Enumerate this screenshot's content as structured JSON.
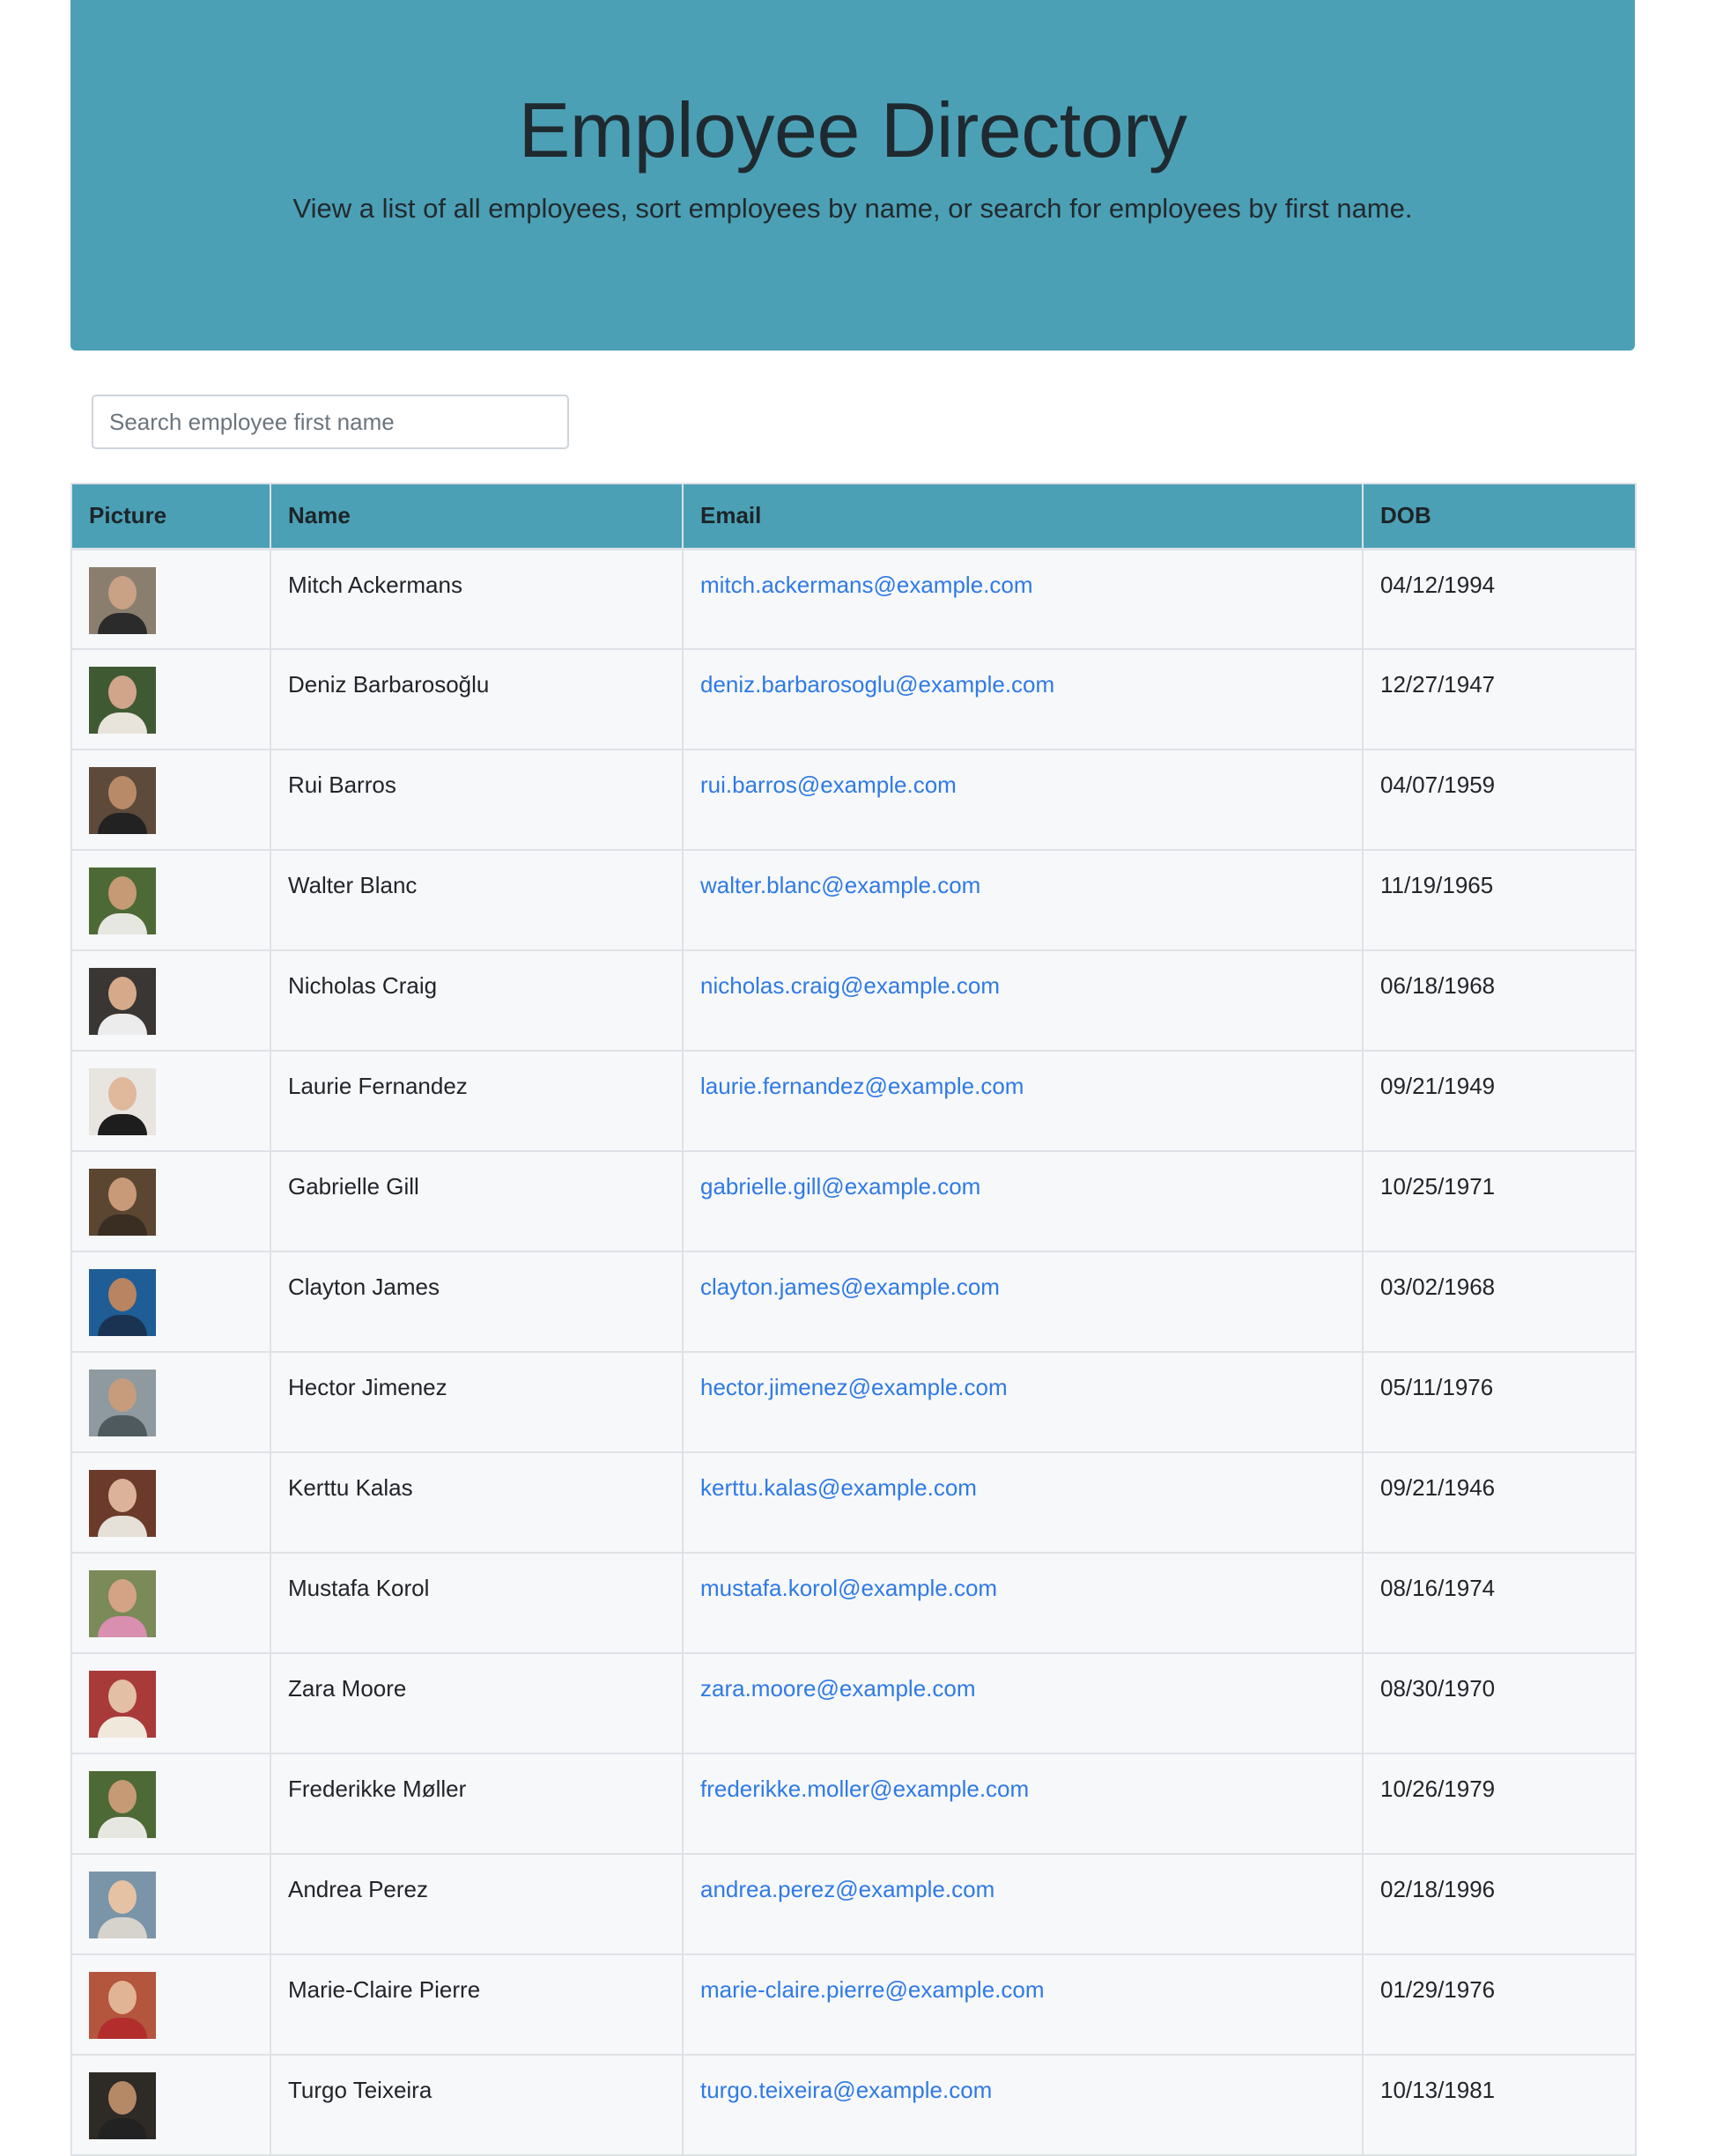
{
  "header": {
    "title": "Employee Directory",
    "subtitle": "View a list of all employees, sort employees by name, or search for employees by first name."
  },
  "search": {
    "placeholder": "Search employee first name",
    "value": ""
  },
  "colors": {
    "accent": "#4ba0b5",
    "link": "#2f7ae5",
    "row_bg": "#f7f8fa",
    "border": "#dee2e6"
  },
  "table": {
    "columns": [
      "Picture",
      "Name",
      "Email",
      "DOB"
    ],
    "rows": [
      {
        "name": "Mitch Ackermans",
        "email": "mitch.ackermans@example.com",
        "dob": "04/12/1994",
        "avatar": {
          "bg": "#8a7f6e",
          "skin": "#c9a184",
          "shirt": "#2b2b2b"
        }
      },
      {
        "name": "Deniz Barbarosoğlu",
        "email": "deniz.barbarosoglu@example.com",
        "dob": "12/27/1947",
        "avatar": {
          "bg": "#3f5a33",
          "skin": "#d0a58a",
          "shirt": "#e8e4dc"
        }
      },
      {
        "name": "Rui Barros",
        "email": "rui.barros@example.com",
        "dob": "04/07/1959",
        "avatar": {
          "bg": "#5d4a3a",
          "skin": "#b98a68",
          "shirt": "#222222"
        }
      },
      {
        "name": "Walter Blanc",
        "email": "walter.blanc@example.com",
        "dob": "11/19/1965",
        "avatar": {
          "bg": "#4d6a36",
          "skin": "#c69a74",
          "shirt": "#e7e7e2"
        }
      },
      {
        "name": "Nicholas Craig",
        "email": "nicholas.craig@example.com",
        "dob": "06/18/1968",
        "avatar": {
          "bg": "#3a3633",
          "skin": "#d5a98a",
          "shirt": "#ececec"
        }
      },
      {
        "name": "Laurie Fernandez",
        "email": "laurie.fernandez@example.com",
        "dob": "09/21/1949",
        "avatar": {
          "bg": "#e8e5e1",
          "skin": "#e0b89c",
          "shirt": "#1d1d1d"
        }
      },
      {
        "name": "Gabrielle Gill",
        "email": "gabrielle.gill@example.com",
        "dob": "10/25/1971",
        "avatar": {
          "bg": "#5b4632",
          "skin": "#c99a78",
          "shirt": "#3a2d22"
        }
      },
      {
        "name": "Clayton James",
        "email": "clayton.james@example.com",
        "dob": "03/02/1968",
        "avatar": {
          "bg": "#1f5d96",
          "skin": "#b88462",
          "shirt": "#1a3352"
        }
      },
      {
        "name": "Hector Jimenez",
        "email": "hector.jimenez@example.com",
        "dob": "05/11/1976",
        "avatar": {
          "bg": "#8e9aa0",
          "skin": "#c69c7c",
          "shirt": "#4f5a5e"
        }
      },
      {
        "name": "Kerttu Kalas",
        "email": "kerttu.kalas@example.com",
        "dob": "09/21/1946",
        "avatar": {
          "bg": "#6c3a2a",
          "skin": "#dcb39a",
          "shirt": "#e5e0d8"
        }
      },
      {
        "name": "Mustafa Korol",
        "email": "mustafa.korol@example.com",
        "dob": "08/16/1974",
        "avatar": {
          "bg": "#7a8a58",
          "skin": "#d4a386",
          "shirt": "#d88fb0"
        }
      },
      {
        "name": "Zara Moore",
        "email": "zara.moore@example.com",
        "dob": "08/30/1970",
        "avatar": {
          "bg": "#a83a3a",
          "skin": "#e2bfa5",
          "shirt": "#f1e8dc"
        }
      },
      {
        "name": "Frederikke Møller",
        "email": "frederikke.moller@example.com",
        "dob": "10/26/1979",
        "avatar": {
          "bg": "#4d6a36",
          "skin": "#c69a74",
          "shirt": "#e7e7e2"
        }
      },
      {
        "name": "Andrea Perez",
        "email": "andrea.perez@example.com",
        "dob": "02/18/1996",
        "avatar": {
          "bg": "#7a95a8",
          "skin": "#e6c2a4",
          "shirt": "#d6d2cc"
        }
      },
      {
        "name": "Marie-Claire Pierre",
        "email": "marie-claire.pierre@example.com",
        "dob": "01/29/1976",
        "avatar": {
          "bg": "#b4553e",
          "skin": "#e2b496",
          "shirt": "#b32d2d"
        }
      },
      {
        "name": "Turgo Teixeira",
        "email": "turgo.teixeira@example.com",
        "dob": "10/13/1981",
        "avatar": {
          "bg": "#2e2a26",
          "skin": "#b58866",
          "shirt": "#222222"
        }
      }
    ]
  }
}
